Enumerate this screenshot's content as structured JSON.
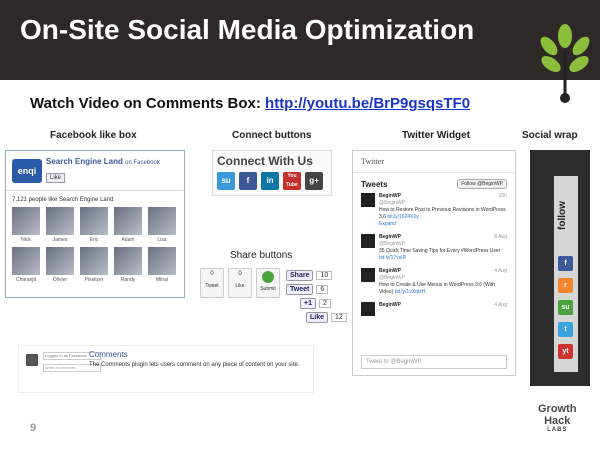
{
  "slide": {
    "title": "On-Site Social Media Optimization",
    "video_prefix": "Watch Video on Comments Box: ",
    "video_link": "http://youtu.be/BrP9gsqsTF0",
    "slide_number": "9",
    "brand_line1": "Growth",
    "brand_line2": "Hack",
    "brand_line3": "LABS"
  },
  "labels": {
    "facebook": "Facebook like box",
    "connect": "Connect buttons",
    "twitter": "Twitter Widget",
    "social_wrap": "Social wrap",
    "share": "Share buttons"
  },
  "facebook_box": {
    "logo": "enqi",
    "page_name": "Search Engine Land",
    "on_facebook": "on Facebook",
    "like_label": "Like",
    "count_text": "7,121 people like Search Engine Land",
    "faces": [
      "Nick",
      "James",
      "Eric",
      "Adam",
      "Lisa",
      "Charanjit",
      "Olivier",
      "Pixelizer",
      "Randy",
      "Mihai"
    ]
  },
  "connect": {
    "title": "Connect With Us",
    "icons": [
      "stumbleupon",
      "facebook",
      "linkedin",
      "youtube",
      "google-plus"
    ],
    "icon_text": [
      "su",
      "f",
      "in",
      "You Tube",
      "g+"
    ],
    "colors": [
      "#3a9ad9",
      "#3b5998",
      "#0e76a8",
      "#c4302b",
      "#444444"
    ]
  },
  "share": {
    "tweet_count": "0",
    "tweet_label": "Tweet",
    "like_count": "0",
    "like_label": "Like",
    "submit_label": "Submit",
    "linkedin_label": "Share",
    "linkedin_count": "10",
    "tweet2_label": "Tweet",
    "tweet2_count": "6",
    "plusone_label": "+1",
    "plusone_count": "2",
    "like2_label": "Like",
    "like2_count": "12"
  },
  "twitter": {
    "label": "Twitter",
    "title": "Tweets",
    "follow": "Follow @BeginWP",
    "input_placeholder": "Tweet to @BeginWP",
    "tweets": [
      {
        "name": "BeginWP",
        "handle": "@BeginWP",
        "date": "15h",
        "text": "How to Restore Post to Previous Revisions in WordPress 3.6 ",
        "link": "bit.ly/1624X0y",
        "extra": "Expand"
      },
      {
        "name": "BeginWP",
        "handle": "@BeginWP",
        "date": "8 Aug",
        "text": "35 Quick Time Saving Tips for Every #WordPress User ",
        "link": "bit.ly/17vsIR",
        "extra": ""
      },
      {
        "name": "BeginWP",
        "handle": "@BeginWP",
        "date": "4 Aug",
        "text": "How to Create & Use Menus in WordPress 3.6 (With Video) ",
        "link": "bit.ly/1sXqfzH",
        "extra": ""
      },
      {
        "name": "BeginWP",
        "handle": "",
        "date": "4 Aug",
        "text": "",
        "link": "",
        "extra": ""
      }
    ]
  },
  "social_wrap": {
    "follow_text": "follow",
    "icons": [
      "facebook",
      "rss",
      "stumbleupon",
      "twitter",
      "youtube"
    ],
    "icon_text": [
      "f",
      "r",
      "su",
      "t",
      "yt"
    ],
    "colors": [
      "#3b5998",
      "#f2862f",
      "#4aa33c",
      "#3aa3e3",
      "#cc3333"
    ]
  },
  "comments": {
    "title": "Comments",
    "description": "The Comments plugin lets users comment on any piece of content on your site.",
    "field1": "Logged in as Facebook",
    "field2": "Write a comment..."
  }
}
